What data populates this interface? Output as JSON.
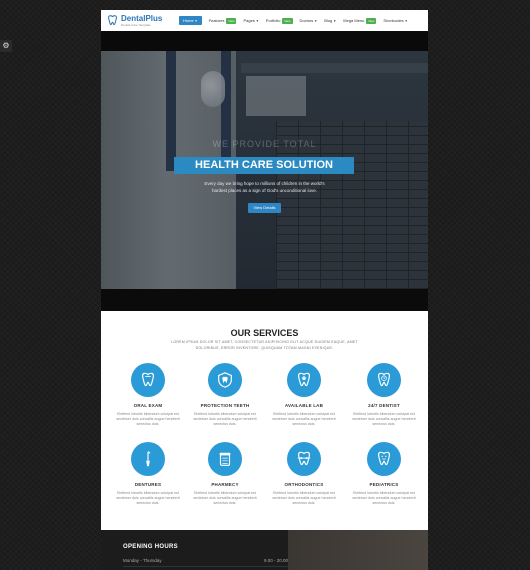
{
  "side_tab_icon": "settings-icon",
  "logo": {
    "name": "DentalPlus",
    "tagline": "Dentist Care Template",
    "icon": "tooth-icon"
  },
  "nav": [
    {
      "label": "Home",
      "active": true,
      "badge": ""
    },
    {
      "label": "Features",
      "active": false,
      "badge": "New"
    },
    {
      "label": "Pages",
      "active": false,
      "badge": ""
    },
    {
      "label": "Portfolio",
      "active": false,
      "badge": "New"
    },
    {
      "label": "Doctors",
      "active": false,
      "badge": ""
    },
    {
      "label": "Blog",
      "active": false,
      "badge": ""
    },
    {
      "label": "Mega Menu",
      "active": false,
      "badge": "New"
    },
    {
      "label": "Shortcodes",
      "active": false,
      "badge": ""
    }
  ],
  "hero": {
    "pretitle": "WE PROVIDE TOTAL",
    "title": "HEALTH CARE SOLUTION",
    "subtitle_line1": "Every day we bring hope to millions of children in the world's",
    "subtitle_line2": "hardest places as a sign of God's unconditional love.",
    "button": "View Details"
  },
  "services": {
    "title": "OUR SERVICES",
    "intro": "LOREM IPSUM DOLOR SIT AMET, CONSECTETUR ADIPISICING ELIT ACQUE DUIDEM EAQUE, AMET DOLORIBUS, ERROR INVENTORE, QUISQUAM TOTAM MAGNI EVENIQUE.",
    "card_text": "Eleifend lobortis bibendum volutpat est sectetuer duis convallis augue hendrerit senectus duis.",
    "items": [
      {
        "title": "ORAL EXAM",
        "icon": "tooth-icon"
      },
      {
        "title": "PROTECTION TEETH",
        "icon": "shield-tooth-icon"
      },
      {
        "title": "AVAILABLE LAB",
        "icon": "tooth-lab-icon"
      },
      {
        "title": "24/7 DENTIST",
        "icon": "tooth-clock-icon"
      },
      {
        "title": "DENTURES",
        "icon": "dental-tool-icon"
      },
      {
        "title": "PHARMECY",
        "icon": "pill-jar-icon"
      },
      {
        "title": "ORTHODONTICS",
        "icon": "braces-icon"
      },
      {
        "title": "PEDIATRICS",
        "icon": "kid-tooth-icon"
      }
    ]
  },
  "opening_hours": {
    "title": "OPENING HOURS",
    "rows": [
      {
        "day": "Monday - Thursday",
        "time": "9.00 - 20.00"
      }
    ]
  },
  "colors": {
    "accent": "#2f86c5",
    "badge": "#4caf50",
    "icon_bg": "#2a9bd6"
  }
}
